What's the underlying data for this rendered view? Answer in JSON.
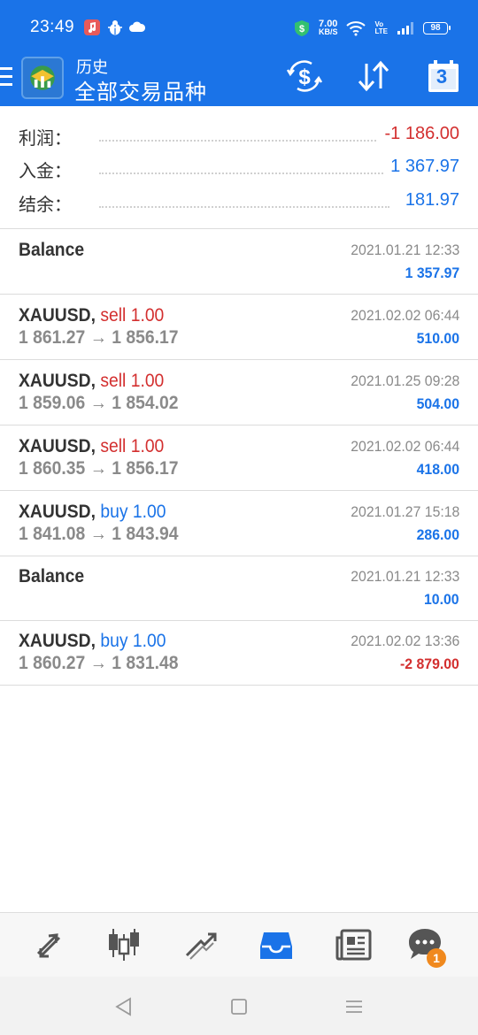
{
  "status_bar": {
    "time": "23:49",
    "net_speed_value": "7.00",
    "net_speed_unit": "KB/S",
    "volte_top": "Vo",
    "volte_bottom": "LTE",
    "battery": "98",
    "icons": [
      "music-app-icon",
      "bug-icon",
      "cloud-icon",
      "shield-dollar-icon",
      "wifi-icon",
      "signal-icon",
      "battery-icon"
    ]
  },
  "header": {
    "subtitle": "历史",
    "title": "全部交易品种",
    "calendar_day": "3",
    "icons": [
      "menu-icon",
      "metatrader-logo-icon",
      "currency-exchange-icon",
      "sort-icon",
      "calendar-icon"
    ]
  },
  "summary": {
    "rows": [
      {
        "label": "利润：",
        "value": "-1 186.00",
        "color": "#d32f2f"
      },
      {
        "label": "入金：",
        "value": "1 367.97",
        "color": "#1a73e8"
      },
      {
        "label": "结余：",
        "value": "181.97",
        "color": "#1a73e8"
      }
    ]
  },
  "deals": [
    {
      "symbol": "Balance",
      "side": "",
      "volume": "",
      "prices": "",
      "date": "2021.01.21 12:33",
      "profit": "1 357.97",
      "profit_sign": "pos"
    },
    {
      "symbol": "XAUUSD,",
      "side": "sell",
      "volume": "1.00",
      "prices": "1 861.27 → 1 856.17",
      "date": "2021.02.02 06:44",
      "profit": "510.00",
      "profit_sign": "pos"
    },
    {
      "symbol": "XAUUSD,",
      "side": "sell",
      "volume": "1.00",
      "prices": "1 859.06 → 1 854.02",
      "date": "2021.01.25 09:28",
      "profit": "504.00",
      "profit_sign": "pos"
    },
    {
      "symbol": "XAUUSD,",
      "side": "sell",
      "volume": "1.00",
      "prices": "1 860.35 → 1 856.17",
      "date": "2021.02.02 06:44",
      "profit": "418.00",
      "profit_sign": "pos"
    },
    {
      "symbol": "XAUUSD,",
      "side": "buy",
      "volume": "1.00",
      "prices": "1 841.08 → 1 843.94",
      "date": "2021.01.27 15:18",
      "profit": "286.00",
      "profit_sign": "pos"
    },
    {
      "symbol": "Balance",
      "side": "",
      "volume": "",
      "prices": "",
      "date": "2021.01.21 12:33",
      "profit": "10.00",
      "profit_sign": "pos"
    },
    {
      "symbol": "XAUUSD,",
      "side": "buy",
      "volume": "1.00",
      "prices": "1 860.27 → 1 831.48",
      "date": "2021.02.02 13:36",
      "profit": "-2 879.00",
      "profit_sign": "neg"
    }
  ],
  "bottom_nav": {
    "items": [
      "quotes-icon",
      "chart-icon",
      "trade-icon",
      "history-icon",
      "news-icon",
      "chat-icon"
    ],
    "active": "history-icon",
    "chat_badge": "1",
    "active_color": "#1a73e8",
    "inactive_color": "#555555"
  },
  "system_nav": {
    "items": [
      "back-icon",
      "home-icon",
      "recents-icon"
    ]
  },
  "colors": {
    "accent": "#1a73e8",
    "loss": "#d32f2f",
    "muted": "#8a8a8a"
  }
}
